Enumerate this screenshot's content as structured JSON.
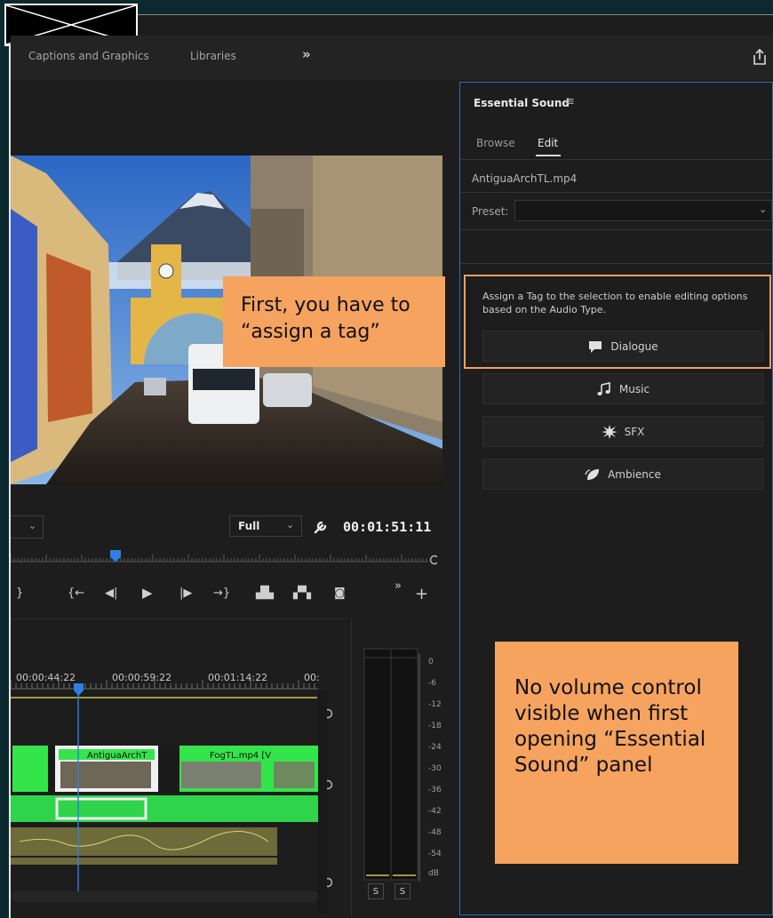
{
  "workspaces": {
    "tabs": [
      "Captions and Graphics",
      "Libraries"
    ],
    "more": "»"
  },
  "monitor": {
    "quality": "Full",
    "timecode": "00:01:51:11"
  },
  "essential_sound": {
    "title": "Essential Sound",
    "menu_icon": "≡",
    "tabs": {
      "browse": "Browse",
      "edit": "Edit"
    },
    "file": "AntiguaArchTL.mp4",
    "preset_label": "Preset:",
    "assign_text": "Assign a Tag to the selection to enable editing options based on the Audio Type.",
    "tags": [
      {
        "label": "Dialogue",
        "icon": "speech-bubble-icon"
      },
      {
        "label": "Music",
        "icon": "music-note-icon"
      },
      {
        "label": "SFX",
        "icon": "burst-icon"
      },
      {
        "label": "Ambience",
        "icon": "leaf-icon"
      }
    ]
  },
  "timeline": {
    "timecodes": [
      "00:00:44:22",
      "00:00:59:22",
      "00:01:14:22",
      "00:"
    ],
    "clips": [
      "AntiguaArchT",
      "FogTL.mp4 [V"
    ]
  },
  "meter": {
    "scale": [
      "0",
      "-6",
      "-12",
      "-18",
      "-24",
      "-30",
      "-36",
      "-42",
      "-48",
      "-54",
      "dB"
    ],
    "solo": [
      "S",
      "S"
    ]
  },
  "annotations": {
    "note1": "First, you have to “assign a tag”",
    "note2": "No volume control visible when first opening “Essential Sound” panel"
  }
}
